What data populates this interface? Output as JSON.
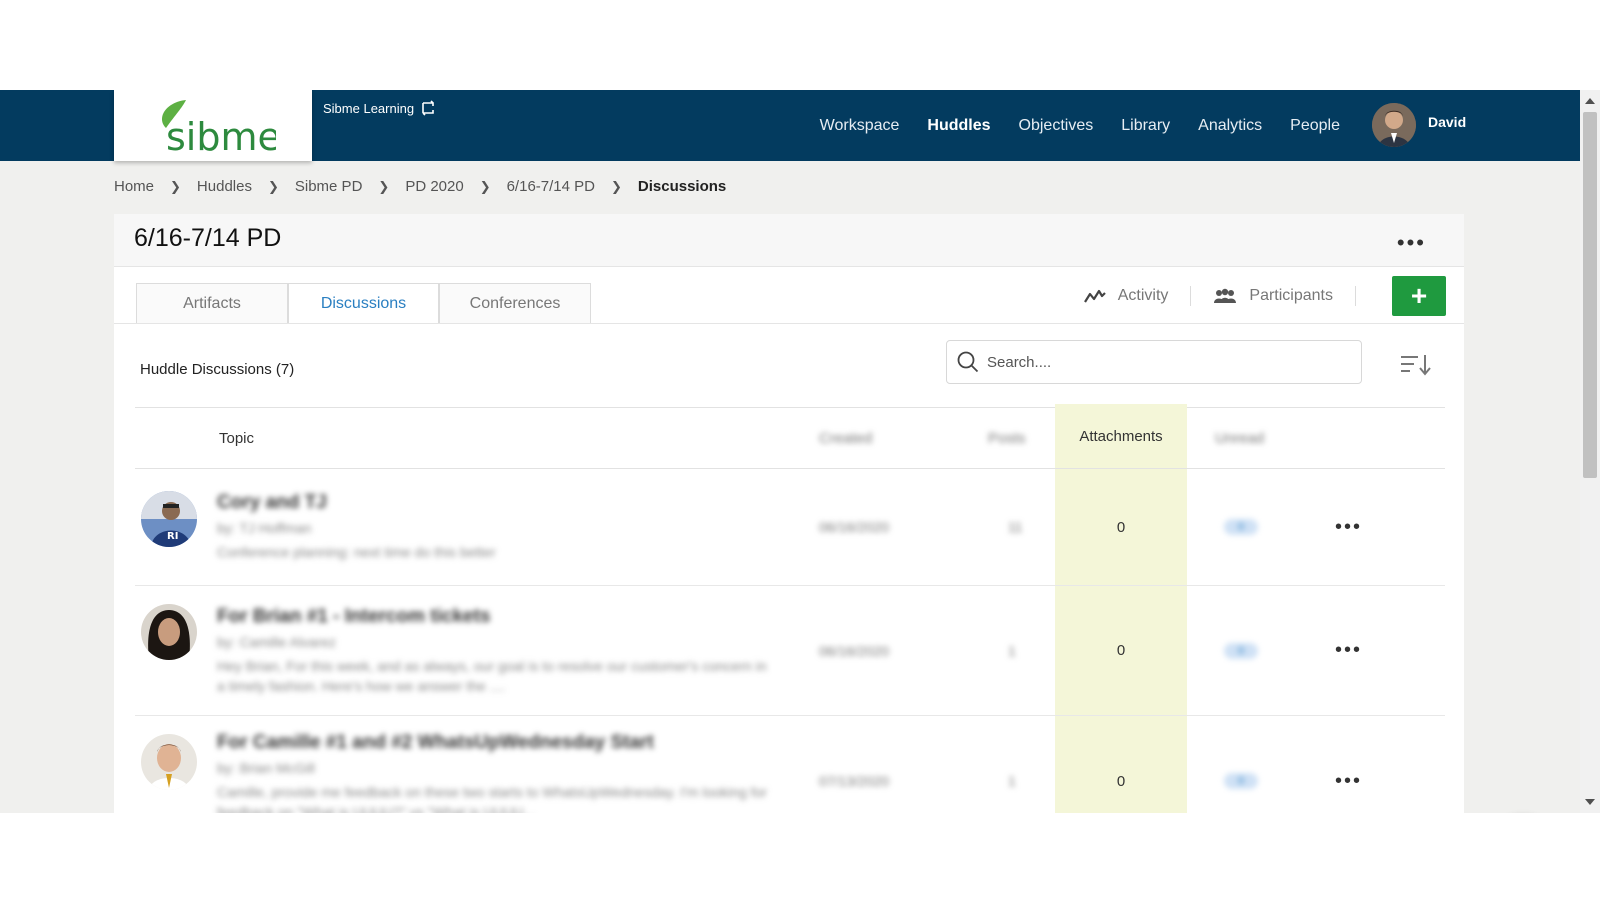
{
  "header": {
    "logo_text": "sibme",
    "account_name": "Sibme Learning",
    "nav": [
      {
        "label": "Workspace",
        "active": false
      },
      {
        "label": "Huddles",
        "active": true
      },
      {
        "label": "Objectives",
        "active": false
      },
      {
        "label": "Library",
        "active": false
      },
      {
        "label": "Analytics",
        "active": false
      },
      {
        "label": "People",
        "active": false
      }
    ],
    "user_name": "David"
  },
  "breadcrumb": [
    "Home",
    "Huddles",
    "Sibme PD",
    "PD 2020",
    "6/16-7/14 PD",
    "Discussions"
  ],
  "page": {
    "title": "6/16-7/14 PD",
    "tabs": [
      {
        "label": "Artifacts",
        "active": false
      },
      {
        "label": "Discussions",
        "active": true
      },
      {
        "label": "Conferences",
        "active": false
      }
    ],
    "actions": {
      "activity": "Activity",
      "participants": "Participants",
      "add": "+"
    },
    "list_title": "Huddle Discussions (7)",
    "search_placeholder": "Search...."
  },
  "table": {
    "columns": {
      "topic": "Topic",
      "created": "Created",
      "posts": "Posts",
      "attachments": "Attachments",
      "unread": "Unread"
    },
    "rows": [
      {
        "title": "Cory and TJ",
        "by": "by: TJ Hoffman",
        "desc": "Conference planning: next time do this better",
        "created": "06/16/2020",
        "posts": "11",
        "attachments": "0",
        "unread": "0"
      },
      {
        "title": "For Brian #1 - Intercom tickets",
        "by": "by: Camille Alvarez",
        "desc": "Hey Brian, For this week, and as always, our goal is to resolve our customer's concern in a timely fashion. Here's how we answer the ....",
        "created": "06/16/2020",
        "posts": "1",
        "attachments": "0",
        "unread": "0"
      },
      {
        "title": "For Camille #1 and #2 WhatsUpWednesday Start",
        "by": "by: Brian McGill",
        "desc": "Camille, provide me feedback on these two starts to WhatsUpWednesday. I'm looking for feedback on \"What is UUUU?\" vs \"What is UUUU...",
        "created": "07/13/2020",
        "posts": "1",
        "attachments": "0",
        "unread": "0"
      }
    ]
  },
  "colors": {
    "navbar": "#033b5f",
    "accent_blue": "#2a7fc1",
    "add_button": "#1f9a3f",
    "attachments_highlight": "#f4f6d8"
  }
}
